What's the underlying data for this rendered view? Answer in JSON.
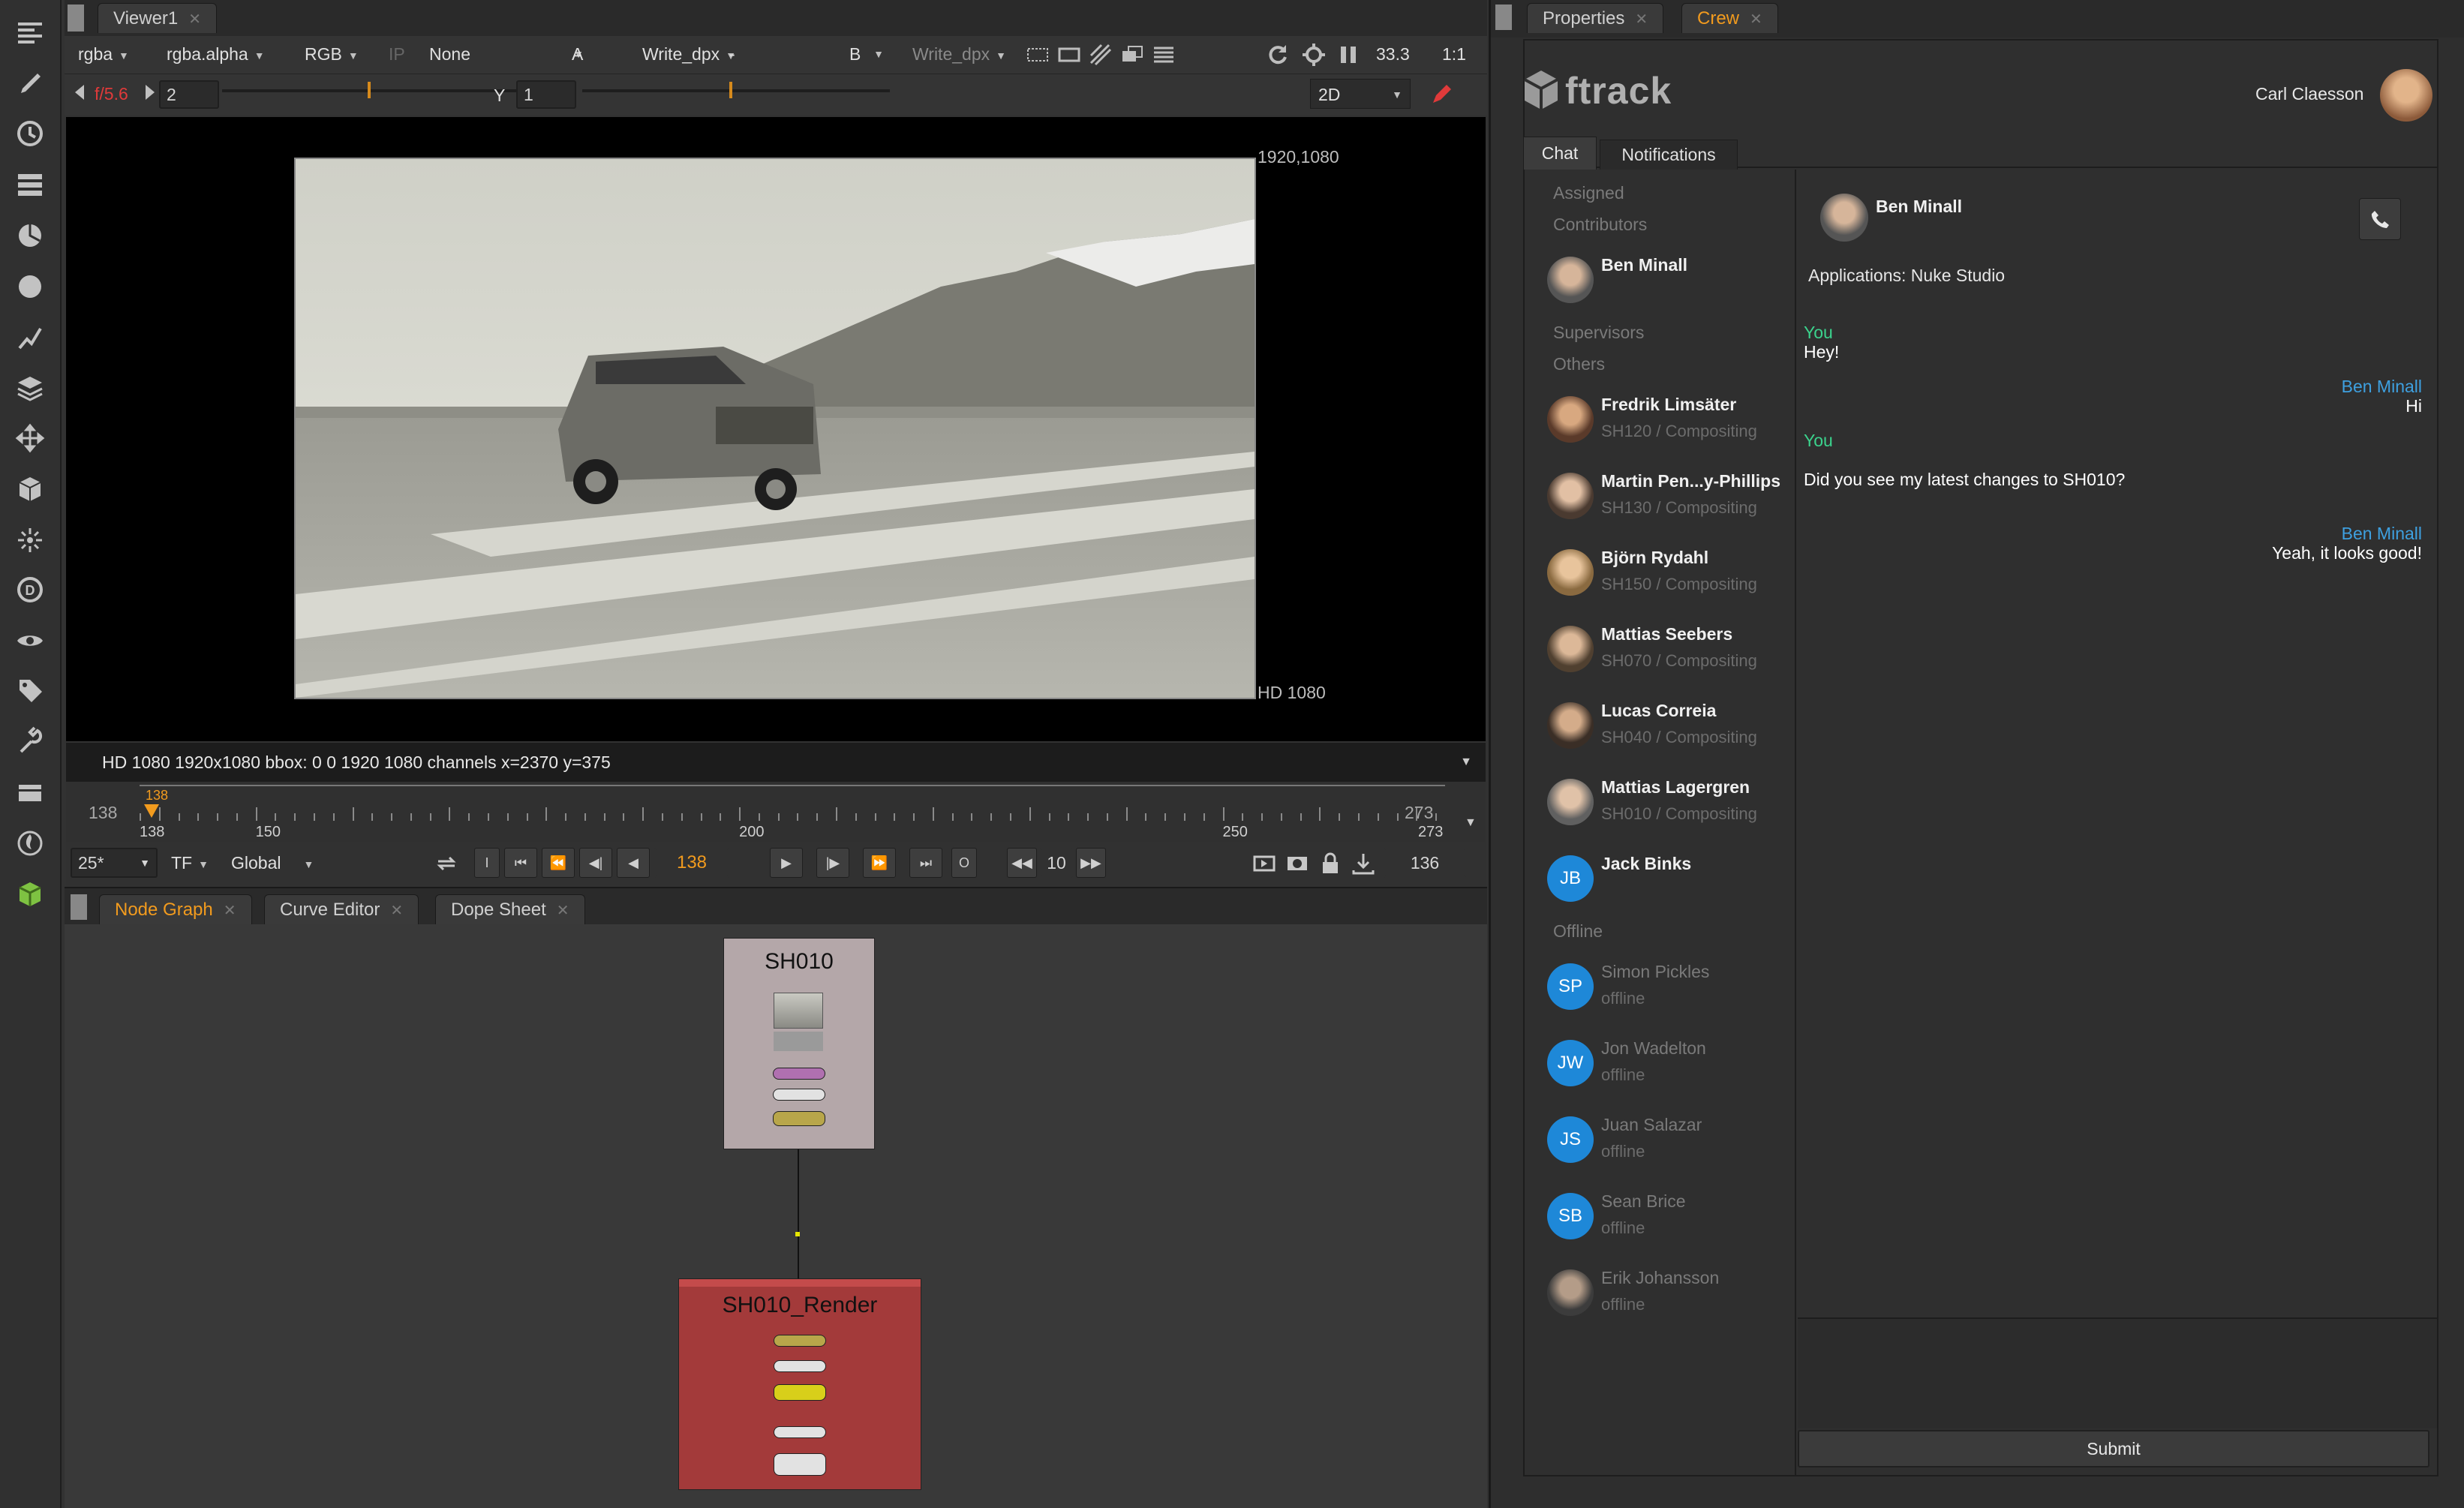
{
  "viewer_tab": "Viewer1",
  "viewer_controls": {
    "channels": "rgba",
    "alpha": "rgba.alpha",
    "colorspace": "RGB",
    "ip": "IP",
    "lut": "None",
    "a_label": "A",
    "a_input": "Write_dpx",
    "dash": "-",
    "b_label": "B",
    "b_input": "Write_dpx",
    "zoom": "33.3",
    "ratio": "1:1",
    "fstop": "f/5.6",
    "gain": "2",
    "y_label": "Y",
    "gamma": "1",
    "view_mode": "2D"
  },
  "image": {
    "size_label": "1920,1080",
    "format_label": "HD 1080"
  },
  "info_bar": "HD 1080 1920x1080  bbox: 0 0 1920 1080 channels  x=2370 y=375",
  "timeline": {
    "start": "138",
    "end": "273",
    "current": "138",
    "labels": [
      "138",
      "150",
      "200",
      "250",
      "273"
    ],
    "fps": "25*",
    "tf": "TF",
    "scope": "Global",
    "frame": "138",
    "increment": "10",
    "frame_right": "136",
    "btn_in": "I",
    "btn_out": "O"
  },
  "node_tabs": [
    "Node Graph",
    "Curve Editor",
    "Dope Sheet"
  ],
  "nodes": {
    "shot": "SH010",
    "render": "SH010_Render"
  },
  "right_tabs": [
    "Properties",
    "Crew"
  ],
  "ftrack": {
    "logo": "ftrack",
    "user": "Carl Claesson",
    "tabs": [
      "Chat",
      "Notifications"
    ],
    "sections": {
      "assigned": "Assigned",
      "contributors": "Contributors",
      "supervisors": "Supervisors",
      "others": "Others",
      "offline": "Offline"
    },
    "contributors": [
      {
        "name": "Ben Minall",
        "sub": ""
      }
    ],
    "others": [
      {
        "name": "Fredrik Limsäter",
        "sub": "SH120 / Compositing"
      },
      {
        "name": "Martin Pen...y-Phillips",
        "sub": "SH130 / Compositing"
      },
      {
        "name": "Björn Rydahl",
        "sub": "SH150 / Compositing"
      },
      {
        "name": "Mattias Seebers",
        "sub": "SH070 / Compositing"
      },
      {
        "name": "Lucas Correia",
        "sub": "SH040 / Compositing"
      },
      {
        "name": "Mattias Lagergren",
        "sub": "SH010 / Compositing"
      },
      {
        "name": "Jack Binks",
        "sub": "",
        "initials": "JB"
      }
    ],
    "offline": [
      {
        "name": "Simon Pickles",
        "sub": "offline",
        "initials": "SP"
      },
      {
        "name": "Jon Wadelton",
        "sub": "offline",
        "initials": "JW"
      },
      {
        "name": "Juan Salazar",
        "sub": "offline",
        "initials": "JS"
      },
      {
        "name": "Sean Brice",
        "sub": "offline",
        "initials": "SB"
      },
      {
        "name": "Erik Johansson",
        "sub": "offline"
      }
    ],
    "chat": {
      "with": "Ben Minall",
      "applications": "Applications: Nuke Studio",
      "messages": [
        {
          "from": "You",
          "text": "Hey!",
          "side": "left"
        },
        {
          "from": "Ben Minall",
          "text": "Hi",
          "side": "right"
        },
        {
          "from": "You",
          "text": "Did you see my latest changes to SH010?",
          "side": "left"
        },
        {
          "from": "Ben Minall",
          "text": "Yeah, it looks good!",
          "side": "right"
        }
      ],
      "submit": "Submit"
    }
  },
  "colors": {
    "accent_orange": "#f29b1e",
    "you_green": "#3bd38d",
    "ben_blue": "#3ea0e0",
    "initials_blue": "#1e88d8",
    "render_node": "#a33a3a",
    "shot_node": "#b4a7a9"
  }
}
